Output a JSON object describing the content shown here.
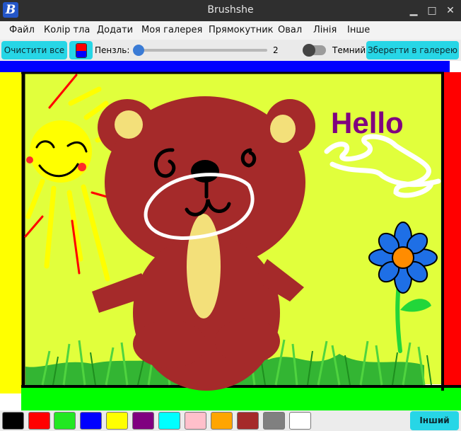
{
  "window": {
    "title": "Brushshe",
    "icon_glyph": "B",
    "minimize_glyph": "▁",
    "maximize_glyph": "□",
    "close_glyph": "✕"
  },
  "menu": {
    "items": [
      "Файл",
      "Колір тла",
      "Додати",
      "Моя галерея",
      "Прямокутник",
      "Овал",
      "Лінія",
      "Інше"
    ]
  },
  "toolbar": {
    "clear_label": "Очистити все",
    "brush_label": "Пензль:",
    "brush_size": "2",
    "brush_slider_fraction": 0.0,
    "dark_label": "Темний",
    "dark_mode_on": false,
    "save_label": "Зберегти в галерею",
    "current_color_fg": "#ff0000",
    "current_color_bg": "#0000ff"
  },
  "canvas": {
    "text": "Hello",
    "text_color": "#800080"
  },
  "palette": {
    "colors": [
      "#000000",
      "#ff0000",
      "#22e822",
      "#0000ff",
      "#ffff00",
      "#800080",
      "#00ffff",
      "#ffc0cb",
      "#ffa500",
      "#a52a2a",
      "#808080",
      "#ffffff"
    ],
    "other_label": "Інший"
  }
}
